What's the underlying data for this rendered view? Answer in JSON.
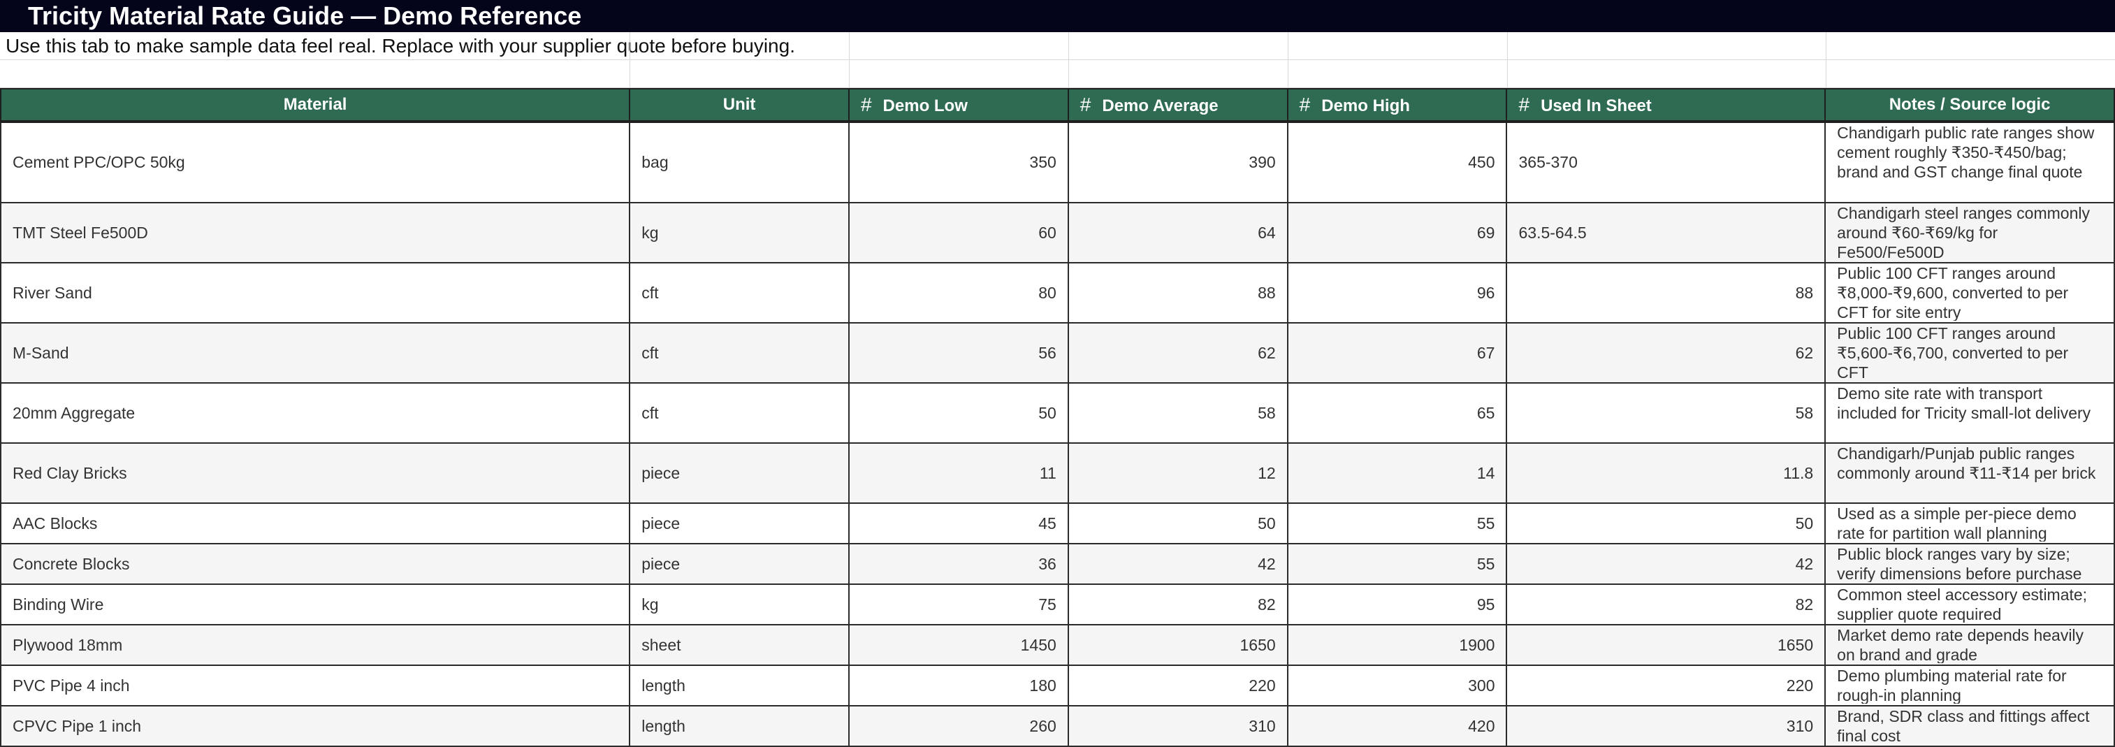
{
  "sheet": {
    "title": "Tricity Material Rate Guide — Demo Reference",
    "subtitle": "Use this tab to make sample data feel real. Replace with your supplier quote before buying."
  },
  "table": {
    "columns": [
      {
        "label": "Material",
        "numeric": false
      },
      {
        "label": "Unit",
        "numeric": false
      },
      {
        "label": "Demo Low",
        "numeric": true
      },
      {
        "label": "Demo Average",
        "numeric": true
      },
      {
        "label": "Demo High",
        "numeric": true
      },
      {
        "label": "Used In Sheet",
        "numeric": true
      },
      {
        "label": "Notes / Source logic",
        "numeric": false
      }
    ],
    "numeric_icon": "#",
    "rows": [
      {
        "material": "Cement PPC/OPC 50kg",
        "unit": "bag",
        "low": "350",
        "avg": "390",
        "high": "450",
        "used": "365-370",
        "used_align": "left",
        "notes": "Chandigarh public rate ranges show cement roughly ₹350-₹450/bag; brand and GST change final quote"
      },
      {
        "material": "TMT Steel Fe500D",
        "unit": "kg",
        "low": "60",
        "avg": "64",
        "high": "69",
        "used": "63.5-64.5",
        "used_align": "left",
        "notes": "Chandigarh steel ranges commonly around ₹60-₹69/kg for Fe500/Fe500D"
      },
      {
        "material": "River Sand",
        "unit": "cft",
        "low": "80",
        "avg": "88",
        "high": "96",
        "used": "88",
        "used_align": "right",
        "notes": "Public 100 CFT ranges around ₹8,000-₹9,600, converted to per CFT for site entry"
      },
      {
        "material": "M-Sand",
        "unit": "cft",
        "low": "56",
        "avg": "62",
        "high": "67",
        "used": "62",
        "used_align": "right",
        "notes": "Public 100 CFT ranges around ₹5,600-₹6,700, converted to per CFT"
      },
      {
        "material": "20mm Aggregate",
        "unit": "cft",
        "low": "50",
        "avg": "58",
        "high": "65",
        "used": "58",
        "used_align": "right",
        "notes": "Demo site rate with transport included for Tricity small-lot delivery"
      },
      {
        "material": "Red Clay Bricks",
        "unit": "piece",
        "low": "11",
        "avg": "12",
        "high": "14",
        "used": "11.8",
        "used_align": "right",
        "notes": "Chandigarh/Punjab public ranges commonly around ₹11-₹14 per brick"
      },
      {
        "material": "AAC Blocks",
        "unit": "piece",
        "low": "45",
        "avg": "50",
        "high": "55",
        "used": "50",
        "used_align": "right",
        "notes": "Used as a simple per-piece demo rate for partition wall planning"
      },
      {
        "material": "Concrete Blocks",
        "unit": "piece",
        "low": "36",
        "avg": "42",
        "high": "55",
        "used": "42",
        "used_align": "right",
        "notes": "Public block ranges vary by size; verify dimensions before purchase"
      },
      {
        "material": "Binding Wire",
        "unit": "kg",
        "low": "75",
        "avg": "82",
        "high": "95",
        "used": "82",
        "used_align": "right",
        "notes": "Common steel accessory estimate; supplier quote required"
      },
      {
        "material": "Plywood 18mm",
        "unit": "sheet",
        "low": "1450",
        "avg": "1650",
        "high": "1900",
        "used": "1650",
        "used_align": "right",
        "notes": "Market demo rate depends heavily on brand and grade"
      },
      {
        "material": "PVC Pipe 4 inch",
        "unit": "length",
        "low": "180",
        "avg": "220",
        "high": "300",
        "used": "220",
        "used_align": "right",
        "notes": "Demo plumbing material rate for rough-in planning"
      },
      {
        "material": "CPVC Pipe 1 inch",
        "unit": "length",
        "low": "260",
        "avg": "310",
        "high": "420",
        "used": "310",
        "used_align": "right",
        "notes": "Brand, SDR class and fittings affect final cost"
      }
    ]
  }
}
